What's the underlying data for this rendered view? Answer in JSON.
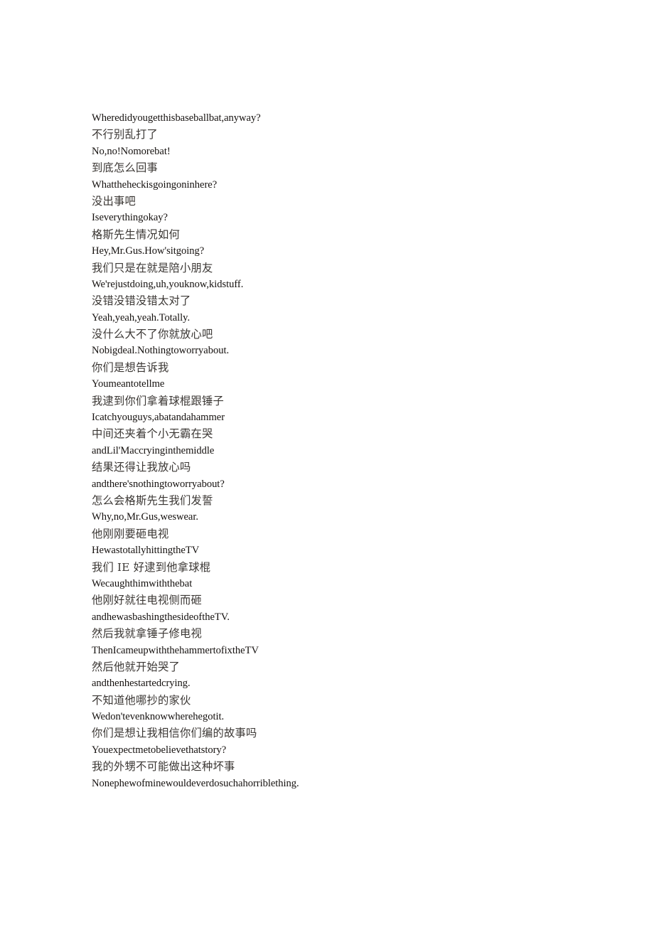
{
  "document": {
    "kind": "bilingual-subtitle-transcript",
    "background_color": "#ffffff",
    "en_text_color": "#15110f",
    "zh_text_color": "#3b3734",
    "lines": [
      {
        "lang": "en",
        "text": "Wheredidyougetthisbaseballbat,anyway?"
      },
      {
        "lang": "zh",
        "text": "不行别乱打了"
      },
      {
        "lang": "en",
        "text": "No,no!Nomorebat!"
      },
      {
        "lang": "zh",
        "text": "到底怎么回事"
      },
      {
        "lang": "en",
        "text": "Whattheheckisgoingoninhere?"
      },
      {
        "lang": "zh",
        "text": "没出事吧"
      },
      {
        "lang": "en",
        "text": "Iseverythingokay?"
      },
      {
        "lang": "zh",
        "text": "格斯先生情况如何"
      },
      {
        "lang": "en",
        "text": "Hey,Mr.Gus.How'sitgoing?"
      },
      {
        "lang": "zh",
        "text": "我们只是在就是陪小朋友"
      },
      {
        "lang": "en",
        "text": "We'rejustdoing,uh,youknow,kidstuff."
      },
      {
        "lang": "zh",
        "text": "没错没错没错太对了"
      },
      {
        "lang": "en",
        "text": "Yeah,yeah,yeah.Totally."
      },
      {
        "lang": "zh",
        "text": "没什么大不了你就放心吧"
      },
      {
        "lang": "en",
        "text": "Nobigdeal.Nothingtoworryabout."
      },
      {
        "lang": "zh",
        "text": "你们是想告诉我"
      },
      {
        "lang": "en",
        "text": "Youmeantotellme"
      },
      {
        "lang": "zh",
        "text": "我逮到你们拿着球棍跟锤子"
      },
      {
        "lang": "en",
        "text": "Icatchyouguys,abatandahammer"
      },
      {
        "lang": "zh",
        "text": "中间还夹着个小无霸在哭"
      },
      {
        "lang": "en",
        "text": "andLil'Maccryinginthemiddle"
      },
      {
        "lang": "zh",
        "text": "结果还得让我放心吗"
      },
      {
        "lang": "en",
        "text": "andthere'snothingtoworryabout?"
      },
      {
        "lang": "zh",
        "text": "怎么会格斯先生我们发誓"
      },
      {
        "lang": "en",
        "text": "Why,no,Mr.Gus,weswear."
      },
      {
        "lang": "zh",
        "text": "他刚刚要砸电视"
      },
      {
        "lang": "en",
        "text": "HewastotallyhittingtheTV"
      },
      {
        "lang": "zh",
        "text": "我们 IE 好逮到他拿球棍"
      },
      {
        "lang": "en",
        "text": "Wecaughthimwiththebat"
      },
      {
        "lang": "zh",
        "text": "他刚好就往电视侧而砸"
      },
      {
        "lang": "en",
        "text": "andhewasbashingthesideoftheTV."
      },
      {
        "lang": "zh",
        "text": "然后我就拿锤子修电视"
      },
      {
        "lang": "en",
        "text": "ThenIcameupwiththehammertofixtheTV"
      },
      {
        "lang": "zh",
        "text": "然后他就开始哭了"
      },
      {
        "lang": "en",
        "text": "andthenhestartedcrying."
      },
      {
        "lang": "zh",
        "text": "不知道他哪抄的家伙"
      },
      {
        "lang": "en",
        "text": "Wedon'tevenknowwherehegotit."
      },
      {
        "lang": "zh",
        "text": "你们是想让我相信你们编的故事吗"
      },
      {
        "lang": "en",
        "text": "Youexpectmetobelievethatstory?"
      },
      {
        "lang": "zh",
        "text": "我的外甥不可能做出这种坏事"
      },
      {
        "lang": "en",
        "text": "Nonephewofminewouldeverdosuchahorriblething."
      }
    ]
  }
}
